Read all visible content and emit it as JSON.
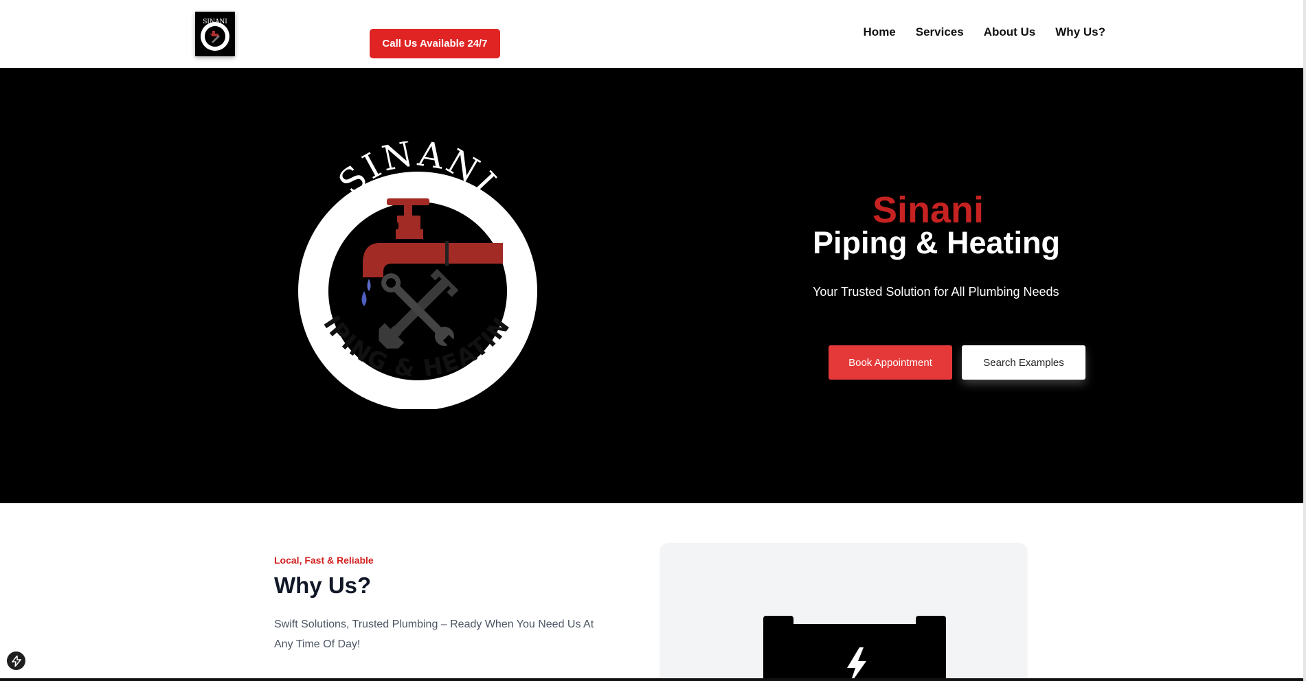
{
  "header": {
    "logo_alt": "Sinani Piping & Heating logo",
    "call_button_label": "Call Us Available 24/7",
    "nav": [
      {
        "label": "Home"
      },
      {
        "label": "Services"
      },
      {
        "label": "About Us"
      },
      {
        "label": "Why Us?"
      }
    ]
  },
  "hero": {
    "logo_text_top": "SINANI",
    "logo_text_bottom": "PIPING & HEATING",
    "title_red": "Sinani",
    "title_white": "Piping & Heating",
    "subtitle": "Your Trusted Solution for All Plumbing Needs",
    "book_label": "Book Appointment",
    "search_label": "Search Examples"
  },
  "why": {
    "eyebrow": "Local, Fast & Reliable",
    "heading": "Why Us?",
    "body": "Swift Solutions, Trusted Plumbing – Ready When You Need Us At Any Time Of Day!",
    "card_icon": "battery-bolt-icon"
  },
  "colors": {
    "brand_red": "#e02424",
    "title_red": "#c62222",
    "hero_bg": "#000000"
  }
}
